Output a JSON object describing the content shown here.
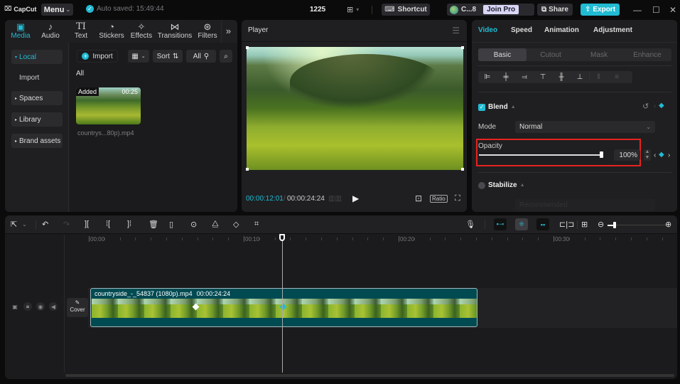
{
  "app": {
    "logo": "CapCut",
    "menu_label": "Menu",
    "autosave": "Auto saved: 15:49:44",
    "project_title": "1225",
    "shortcut_label": "Shortcut",
    "account_name": "C...8",
    "join_pro_label": "Join Pro",
    "share_label": "Share",
    "export_label": "Export",
    "accent": "#21bbd3"
  },
  "media_panel": {
    "tabs": [
      {
        "label": "Media",
        "icon": "media-icon",
        "glyph": "▣"
      },
      {
        "label": "Audio",
        "icon": "audio-icon",
        "glyph": "♪"
      },
      {
        "label": "Text",
        "icon": "text-icon",
        "glyph": "TI"
      },
      {
        "label": "Stickers",
        "icon": "stickers-icon",
        "glyph": "◔"
      },
      {
        "label": "Effects",
        "icon": "effects-icon",
        "glyph": "✧"
      },
      {
        "label": "Transitions",
        "icon": "transitions-icon",
        "glyph": "⋈"
      },
      {
        "label": "Filters",
        "icon": "filters-icon",
        "glyph": "⊛"
      }
    ],
    "more_glyph": "»",
    "sidebar": {
      "local": "Local",
      "import": "Import",
      "spaces": "Spaces",
      "library": "Library",
      "brand_assets": "Brand assets"
    },
    "toolbar": {
      "import_label": "Import",
      "sort_label": "Sort",
      "all_label": "All"
    },
    "section_label": "All",
    "items": [
      {
        "badge": "Added",
        "duration": "00:25",
        "name": "countrys...80p).mp4"
      }
    ]
  },
  "player": {
    "title": "Player",
    "current_time": "00:00:12:01",
    "total_time": "00:00:24:24",
    "ratio_label": "Ratio"
  },
  "properties": {
    "tabs": [
      "Video",
      "Speed",
      "Animation",
      "Adjustment"
    ],
    "active_tab": "Video",
    "subtabs": [
      "Basic",
      "Cutout",
      "Mask",
      "Enhance"
    ],
    "active_subtab": "Basic",
    "blend": {
      "label": "Blend",
      "enabled": true,
      "mode_label": "Mode",
      "mode_value": "Normal",
      "opacity_label": "Opacity",
      "opacity_value": "100%",
      "opacity_percent": 100
    },
    "stabilize": {
      "label": "Stabilize",
      "enabled": false,
      "level_value": "Recommended"
    }
  },
  "timeline": {
    "ruler_labels": [
      "00:00",
      "00:10",
      "00:20",
      "00:30"
    ],
    "cover_label": "Cover",
    "clip": {
      "name": "countryside_-_54837 (1080p).mp4",
      "duration": "00:00:24:24"
    },
    "playhead_time": "00:00:12:01"
  }
}
